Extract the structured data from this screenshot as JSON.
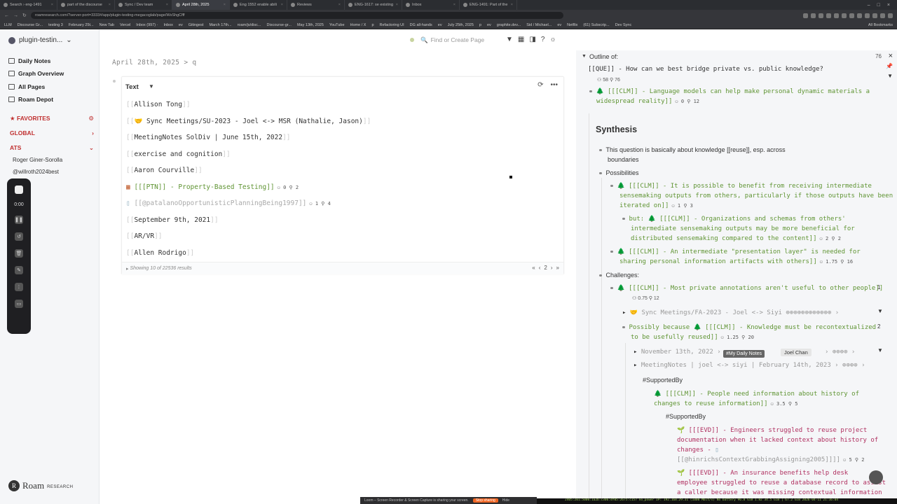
{
  "browser": {
    "tabs": [
      {
        "title": "Search › eng-1491"
      },
      {
        "title": "part of the discourse"
      },
      {
        "title": "Sync / Dev team"
      },
      {
        "title": "April 28th, 2025"
      },
      {
        "title": "Eng 1552 enable abili"
      },
      {
        "title": "Reviews"
      },
      {
        "title": "ENG-1617: se existing"
      },
      {
        "title": "Inbox"
      },
      {
        "title": "ENG-1491: Part of the"
      }
    ],
    "url": "roamresearch.com/?server-port=3333#/app/plugin-testing-megacoglab/page/WsShgCfff",
    "bookmarks": [
      "LLM",
      "Discourse Gr...",
      "testing 3",
      "February 25t...",
      "New Tab",
      "Vercel",
      "Inbox (997) ·",
      "Inbox",
      "ev",
      "Gitingest",
      "March 17th...",
      "roam/js/disc...",
      "Discourse-gr...",
      "May 13th, 2025",
      "YouTube",
      "Home / X",
      "p",
      "Refactoring UI",
      "DG all-hands",
      "ev",
      "July 25th, 2025",
      "p",
      "ev",
      "graphite.dev...",
      "Sid / Michael...",
      "ev",
      "Netflix",
      "(61) Subscrip...",
      "Dev Sync",
      "All Bookmarks"
    ]
  },
  "sidebar": {
    "graph_name": "plugin-testin...",
    "nav": [
      {
        "label": "Daily Notes"
      },
      {
        "label": "Graph Overview"
      },
      {
        "label": "All Pages"
      },
      {
        "label": "Roam Depot"
      }
    ],
    "favorites_label": "FAVORITES",
    "global_label": "GLOBAL",
    "ats_label": "ATS",
    "shortcuts": [
      "Roger Giner-Sorolla",
      "@willroth2024best"
    ],
    "logo": "Roam",
    "logo_sub": "RESEARCH"
  },
  "loom": {
    "time": "0:00"
  },
  "topbar": {
    "search_placeholder": "Find or Create Page"
  },
  "main": {
    "breadcrumb_date": "April 28th, 2025",
    "breadcrumb_sep": ">",
    "breadcrumb_page": "q",
    "query": {
      "header": "Text",
      "results": [
        {
          "text": "Allison Tong"
        },
        {
          "text": "🤝 Sync Meetings/SU-2023 - Joel <-> MSR (Nathalie, Jason)"
        },
        {
          "text": "MeetingNotes SolDiv | June 15th, 2022"
        },
        {
          "text": "exercise and cognition"
        },
        {
          "text": "Aaron Courville"
        },
        {
          "text": "[[[PTN]] - Property-Based Testing]]",
          "c1": "0",
          "c2": "2"
        },
        {
          "text": "[[@patalanoOpportunisticPlanningBeing1997]]",
          "c1": "1",
          "c2": "4"
        },
        {
          "text": "September 9th, 2021"
        },
        {
          "text": "AR/VR"
        },
        {
          "text": "Allen Rodrigo"
        }
      ],
      "footer": "Showing 10 of 22536 results",
      "page": "2"
    }
  },
  "right": {
    "outline_label": "Outline of:",
    "count": "76",
    "question": "[[QUE]] - How can we best bridge private vs. public knowledge?",
    "q_meta1": "58",
    "q_meta2": "76",
    "claim1": "[[[CLM]] - Language models can help make personal dynamic materials a",
    "claim1b": "widespread reality]]",
    "claim1_m1": "0",
    "claim1_m2": "12",
    "synthesis": "Synthesis",
    "s1": "This question is basically about knowledge [[reuse]], esp. across",
    "s1b": "boundaries",
    "possibilities": "Possibilities",
    "p1a": "[[[CLM]] - It is possible to benefit from receiving intermediate",
    "p1b": "sensemaking outputs from others, particularly if those outputs have been",
    "p1c": "iterated on]]",
    "p1_m1": "1",
    "p1_m2": "3",
    "p2a": "but: 🌲 [[[CLM]] - Organizations and schemas from others'",
    "p2b": "intermediate sensemaking outputs may be more beneficial for",
    "p2c": "distributed sensemaking compared to the content]]",
    "p2_m1": "2",
    "p2_m2": "2",
    "p3a": "[[[CLM]] - An intermediate \"presentation layer\" is needed for",
    "p3b": "sharing personal information artifacts with others]]",
    "p3_m1": "1.75",
    "p3_m2": "16",
    "challenges": "Challenges:",
    "c1": "[[[CLM]] - Most private annotations aren't useful to other people]]",
    "c1_m1": "0.75",
    "c1_m2": "12",
    "c1_side": "1",
    "sync_line": "🤝 Sync Meetings/FA-2023 - Joel <-> Siyi ⊕⊕⊕⊕⊕⊕⊕⊕⊕⊕⊕⊕ ›",
    "poss_a": "Possibly because 🌲 [[[CLM]] - Knowledge must be recontextualized",
    "poss_b": "to be usefully reused]]",
    "poss_m1": "1.25",
    "poss_m2": "20",
    "poss_side": "2",
    "nov_line": "November 13th, 2022 ›",
    "tooltip": "#My Daily Notes",
    "chip": "Joel Chan",
    "nov_tail": "› ⊕⊕⊕⊕ ›",
    "mn_line": "MeetingNotes | joel <-> siyi | February 14th, 2023 › ⊕⊕⊕⊕ ›",
    "supported1": "#SupportedBy",
    "info_a": "[[[CLM]] - People need information about history of",
    "info_b": "changes to reuse information]]",
    "info_m1": "3.5",
    "info_m2": "5",
    "supported2": "#SupportedBy",
    "evd1a": "[[[EVD]] - Engineers struggled to reuse project",
    "evd1b": "documentation when it lacked context about history of",
    "evd1c": "changes -",
    "evd1d": "[[@hinrichsContextGrabbingAssigning2005]]]]",
    "evd1_m1": "5",
    "evd1_m2": "2",
    "evd2a": "[[[EVD]] - An insurance benefits help desk",
    "evd2b": "employee struggled to reuse a database record to assist",
    "evd2c": "a caller because it was missing contextual information"
  },
  "bottom": {
    "loom_text": "Loom – Screen Recorder & Screen Capture is sharing your screen.",
    "stop": "Stop sharing",
    "hide": "Hide",
    "status": "2405:201:5000:1a2b:c306:df05:2675:c157  no_power  IP: 192.168.29.31 (1000 Mbit/s)  No battery 96.8 GiB 1.82 34.5 GiB | 67.2 GiB  2026-04-11 21:16:04"
  },
  "colors": {
    "claim": "#5f9433",
    "evidence": "#b03060",
    "favorites": "#c03030",
    "sidebar_bg": "#f5f6f8"
  }
}
